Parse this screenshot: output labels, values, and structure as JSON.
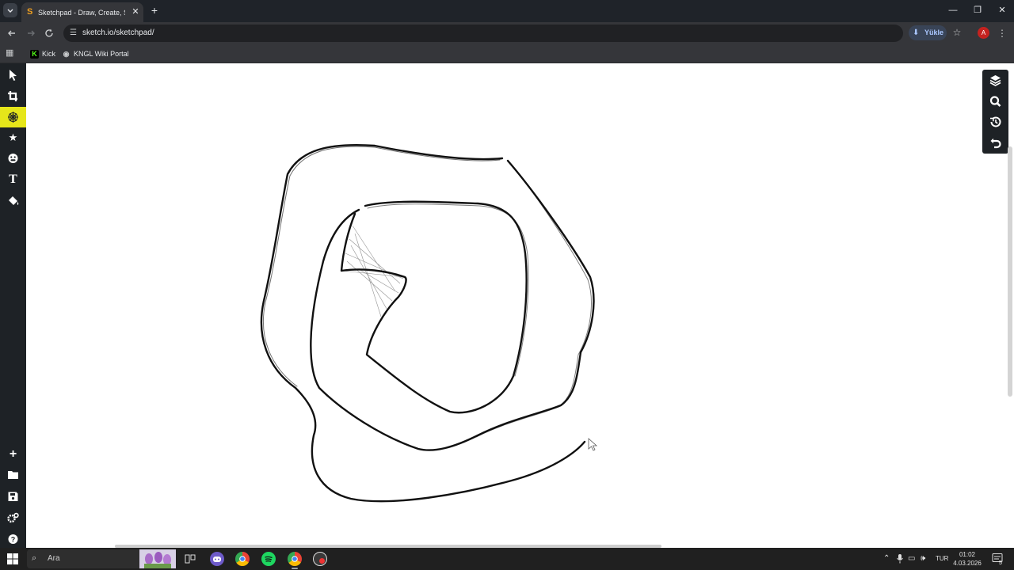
{
  "browser": {
    "tab_title": "Sketchpad - Draw, Create, Sha",
    "tab_favicon": "sketchpad-favicon",
    "url": "sketch.io/sketchpad/",
    "install_label": "Yükle",
    "profile_initial": "A",
    "bookmarks": [
      {
        "label": "Kick",
        "icon": "kick-icon",
        "color": "#53fc18"
      },
      {
        "label": "KNGL Wiki Portal",
        "icon": "wiki-icon",
        "color": "#c8cacc"
      }
    ]
  },
  "sketchpad": {
    "left_tools": [
      {
        "name": "select-tool",
        "icon": "cursor-icon"
      },
      {
        "name": "crop-tool",
        "icon": "crop-icon"
      },
      {
        "name": "brush-tool",
        "icon": "web-brush-icon",
        "active": true
      },
      {
        "name": "stamp-tool",
        "icon": "star-icon"
      },
      {
        "name": "emoji-tool",
        "icon": "emoji-icon"
      },
      {
        "name": "text-tool",
        "icon": "text-icon"
      },
      {
        "name": "fill-tool",
        "icon": "paint-bucket-icon"
      }
    ],
    "bottom_tools": [
      {
        "name": "new-button",
        "icon": "plus-icon"
      },
      {
        "name": "open-button",
        "icon": "folder-icon"
      },
      {
        "name": "save-button",
        "icon": "save-icon"
      },
      {
        "name": "settings-button",
        "icon": "gears-icon"
      },
      {
        "name": "help-button",
        "icon": "help-icon"
      }
    ],
    "right_tools": [
      {
        "name": "layers-button",
        "icon": "layers-icon"
      },
      {
        "name": "zoom-button",
        "icon": "search-icon"
      },
      {
        "name": "history-button",
        "icon": "history-icon"
      },
      {
        "name": "undo-button",
        "icon": "undo-icon"
      }
    ],
    "active_color": "#e6e61a"
  },
  "taskbar": {
    "search_placeholder": "Ara",
    "apps": [
      {
        "name": "task-view",
        "icon": "task-view-icon"
      },
      {
        "name": "discord",
        "icon": "discord-icon"
      },
      {
        "name": "chrome",
        "icon": "chrome-icon"
      },
      {
        "name": "spotify",
        "icon": "spotify-icon"
      },
      {
        "name": "chrome-profile",
        "icon": "chrome-icon"
      },
      {
        "name": "screen-recorder",
        "icon": "recorder-icon"
      }
    ],
    "language": "TUR",
    "time": "01:02",
    "date": "4.03.2026",
    "notification_count": "5"
  }
}
